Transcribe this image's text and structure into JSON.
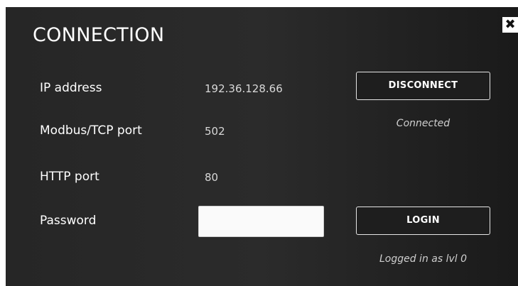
{
  "dialog": {
    "title": "CONNECTION",
    "close_icon": "close-icon"
  },
  "fields": {
    "ip_label": "IP address",
    "ip_value": "192.36.128.66",
    "modbus_label": "Modbus/TCP port",
    "modbus_value": "502",
    "http_label": "HTTP port",
    "http_value": "80",
    "password_label": "Password",
    "password_value": ""
  },
  "actions": {
    "disconnect_label": "DISCONNECT",
    "connection_status": "Connected",
    "login_label": "LOGIN",
    "login_status": "Logged in as lvl 0"
  }
}
